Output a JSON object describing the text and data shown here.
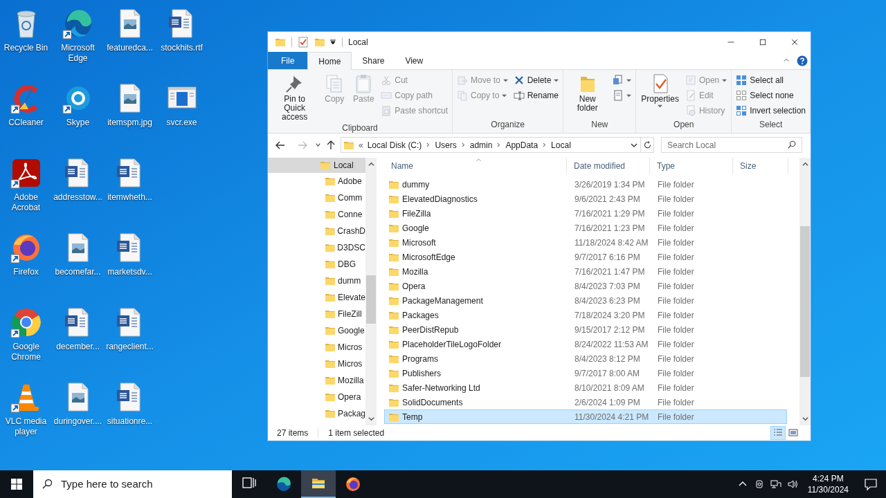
{
  "desktop_columns": [
    [
      {
        "label": "Recycle Bin",
        "kind": "recycle_bin",
        "shortcut": false
      },
      {
        "label": "CCleaner",
        "kind": "ccleaner",
        "shortcut": true
      },
      {
        "label": "Adobe Acrobat",
        "kind": "acrobat",
        "shortcut": true
      },
      {
        "label": "Firefox",
        "kind": "firefox",
        "shortcut": true
      },
      {
        "label": "Google Chrome",
        "kind": "chrome",
        "shortcut": true
      },
      {
        "label": "VLC media player",
        "kind": "vlc",
        "shortcut": true
      }
    ],
    [
      {
        "label": "Microsoft Edge",
        "kind": "edge",
        "shortcut": true
      },
      {
        "label": "Skype",
        "kind": "skype",
        "shortcut": true
      },
      {
        "label": "addresstow...",
        "kind": "word",
        "shortcut": false
      },
      {
        "label": "becomefar...",
        "kind": "image",
        "shortcut": false
      },
      {
        "label": "december...",
        "kind": "word",
        "shortcut": false
      },
      {
        "label": "duringover....",
        "kind": "image",
        "shortcut": false
      }
    ],
    [
      {
        "label": "featuredca...",
        "kind": "image",
        "shortcut": false
      },
      {
        "label": "itemspm.jpg",
        "kind": "image",
        "shortcut": false
      },
      {
        "label": "itemwheth...",
        "kind": "word",
        "shortcut": false
      },
      {
        "label": "marketsdv...",
        "kind": "word",
        "shortcut": false
      },
      {
        "label": "rangeclient...",
        "kind": "word",
        "shortcut": false
      },
      {
        "label": "situationre...",
        "kind": "word",
        "shortcut": false
      }
    ],
    [
      {
        "label": "stockhits.rtf",
        "kind": "word",
        "shortcut": false
      },
      {
        "label": "svcr.exe",
        "kind": "exe",
        "shortcut": false
      }
    ]
  ],
  "window": {
    "title": "Local"
  },
  "ribbon_tabs": [
    {
      "label": "File",
      "kind": "file",
      "selected": false
    },
    {
      "label": "Home",
      "kind": "tab",
      "selected": true
    },
    {
      "label": "Share",
      "kind": "tab",
      "selected": false
    },
    {
      "label": "View",
      "kind": "tab",
      "selected": false
    }
  ],
  "ribbon_groups": [
    {
      "label": "Clipboard",
      "parts": [
        {
          "kind": "large",
          "label": "Pin to Quick access",
          "disabled": false,
          "dropdown": false
        },
        {
          "kind": "large",
          "label": "Copy",
          "disabled": true,
          "dropdown": false
        },
        {
          "kind": "large",
          "label": "Paste",
          "disabled": true,
          "dropdown": false
        },
        {
          "kind": "stack",
          "items": [
            {
              "label": "Cut",
              "disabled": true,
              "dropdown": false
            },
            {
              "label": "Copy path",
              "disabled": true,
              "dropdown": false
            },
            {
              "label": "Paste shortcut",
              "disabled": true,
              "dropdown": false
            }
          ]
        }
      ]
    },
    {
      "label": "Organize",
      "parts": [
        {
          "kind": "stack",
          "items": [
            {
              "label": "Move to",
              "disabled": true,
              "dropdown": true
            },
            {
              "label": "Copy to",
              "disabled": true,
              "dropdown": true
            }
          ]
        },
        {
          "kind": "stack",
          "items": [
            {
              "label": "Delete",
              "disabled": false,
              "dropdown": true
            },
            {
              "label": "Rename",
              "disabled": false,
              "dropdown": false
            }
          ]
        }
      ]
    },
    {
      "label": "New",
      "parts": [
        {
          "kind": "large",
          "label": "New folder",
          "disabled": false,
          "dropdown": false
        },
        {
          "kind": "stack",
          "items": [
            {
              "disabled": false,
              "dropdown": true
            },
            {
              "disabled": false,
              "dropdown": true
            }
          ]
        }
      ]
    },
    {
      "label": "Open",
      "parts": [
        {
          "kind": "large",
          "label": "Properties",
          "disabled": false,
          "dropdown": true
        },
        {
          "kind": "stack",
          "items": [
            {
              "label": "Open",
              "disabled": true,
              "dropdown": true
            },
            {
              "label": "Edit",
              "disabled": true,
              "dropdown": false
            },
            {
              "label": "History",
              "disabled": true,
              "dropdown": false
            }
          ]
        }
      ]
    },
    {
      "label": "Select",
      "parts": [
        {
          "kind": "stack",
          "items": [
            {
              "label": "Select all",
              "disabled": false,
              "dropdown": false
            },
            {
              "label": "Select none",
              "disabled": false,
              "dropdown": false
            },
            {
              "label": "Invert selection",
              "disabled": false,
              "dropdown": false
            }
          ]
        }
      ]
    }
  ],
  "address_bar": {
    "overflow": "«",
    "breadcrumbs": [
      "Local Disk (C:)",
      "Users",
      "admin",
      "AppData",
      "Local"
    ]
  },
  "search": {
    "placeholder": "Search Local"
  },
  "nav_tree": [
    {
      "label": "Local",
      "selected": true,
      "children": [
        {
          "label": "Adobe",
          "selected": false
        },
        {
          "label": "Comm",
          "selected": false
        },
        {
          "label": "Conne",
          "selected": false
        },
        {
          "label": "CrashD",
          "selected": false
        },
        {
          "label": "D3DSC",
          "selected": false
        },
        {
          "label": "DBG",
          "selected": false
        },
        {
          "label": "dumm",
          "selected": false
        },
        {
          "label": "Elevate",
          "selected": false
        },
        {
          "label": "FileZill",
          "selected": false
        },
        {
          "label": "Google",
          "selected": false
        },
        {
          "label": "Micros",
          "selected": false
        },
        {
          "label": "Micros",
          "selected": false
        },
        {
          "label": "Mozilla",
          "selected": false
        },
        {
          "label": "Opera",
          "selected": false
        },
        {
          "label": "Packag",
          "selected": false
        }
      ]
    }
  ],
  "columns": [
    {
      "label": "Name",
      "sorted": true
    },
    {
      "label": "Date modified",
      "sorted": false
    },
    {
      "label": "Type",
      "sorted": false
    },
    {
      "label": "Size",
      "sorted": false
    }
  ],
  "rows": [
    {
      "name": "dummy",
      "date": "3/26/2019 1:34 PM",
      "type": "File folder",
      "selected": false
    },
    {
      "name": "ElevatedDiagnostics",
      "date": "9/6/2021 2:43 PM",
      "type": "File folder",
      "selected": false
    },
    {
      "name": "FileZilla",
      "date": "7/16/2021 1:29 PM",
      "type": "File folder",
      "selected": false
    },
    {
      "name": "Google",
      "date": "7/16/2021 1:23 PM",
      "type": "File folder",
      "selected": false
    },
    {
      "name": "Microsoft",
      "date": "11/18/2024 8:42 AM",
      "type": "File folder",
      "selected": false
    },
    {
      "name": "MicrosoftEdge",
      "date": "9/7/2017 6:16 PM",
      "type": "File folder",
      "selected": false
    },
    {
      "name": "Mozilla",
      "date": "7/16/2021 1:47 PM",
      "type": "File folder",
      "selected": false
    },
    {
      "name": "Opera",
      "date": "8/4/2023 7:03 PM",
      "type": "File folder",
      "selected": false
    },
    {
      "name": "PackageManagement",
      "date": "8/4/2023 6:23 PM",
      "type": "File folder",
      "selected": false
    },
    {
      "name": "Packages",
      "date": "7/18/2024 3:20 PM",
      "type": "File folder",
      "selected": false
    },
    {
      "name": "PeerDistRepub",
      "date": "9/15/2017 2:12 PM",
      "type": "File folder",
      "selected": false
    },
    {
      "name": "PlaceholderTileLogoFolder",
      "date": "8/24/2022 11:53 AM",
      "type": "File folder",
      "selected": false
    },
    {
      "name": "Programs",
      "date": "8/4/2023 8:12 PM",
      "type": "File folder",
      "selected": false
    },
    {
      "name": "Publishers",
      "date": "9/7/2017 8:00 AM",
      "type": "File folder",
      "selected": false
    },
    {
      "name": "Safer-Networking Ltd",
      "date": "8/10/2021 8:09 AM",
      "type": "File folder",
      "selected": false
    },
    {
      "name": "SolidDocuments",
      "date": "2/6/2024 1:09 PM",
      "type": "File folder",
      "selected": false
    },
    {
      "name": "Temp",
      "date": "11/30/2024 4:21 PM",
      "type": "File folder",
      "selected": true
    }
  ],
  "status_bar": {
    "item_count": "27 items",
    "selection": "1 item selected"
  },
  "view_buttons": [
    {
      "kind": "details",
      "selected": true
    },
    {
      "kind": "large_icons",
      "selected": false
    }
  ],
  "taskbar": {
    "search_placeholder": "Type here to search",
    "apps": [
      {
        "kind": "task_view",
        "active": false
      },
      {
        "kind": "edge",
        "active": false
      },
      {
        "kind": "file_explorer",
        "active": true
      },
      {
        "kind": "firefox",
        "active": false
      }
    ],
    "time": "4:24 PM",
    "date": "11/30/2024"
  }
}
